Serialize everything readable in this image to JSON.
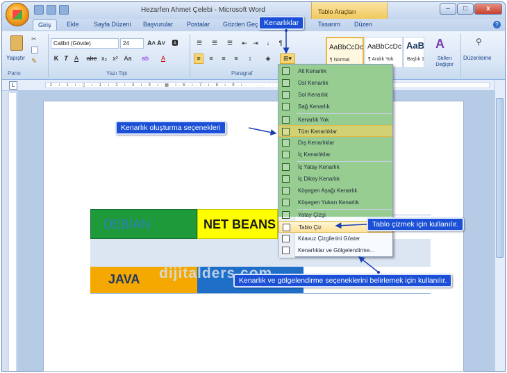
{
  "window": {
    "title": "Hezarfen Ahmet Çelebi - Microsoft Word",
    "context_tab_group": "Tablo Araçları"
  },
  "tabs": [
    {
      "label": "Giriş"
    },
    {
      "label": "Ekle"
    },
    {
      "label": "Sayfa Düzeni"
    },
    {
      "label": "Başvurular"
    },
    {
      "label": "Postalar"
    },
    {
      "label": "Gözden Geçi"
    },
    {
      "label": "Tasarım"
    },
    {
      "label": "Düzen"
    }
  ],
  "ribbon": {
    "paste_label": "Yapıştır",
    "font_name": "Calibri (Gövde)",
    "font_size": "24",
    "bold": "K",
    "italic": "T",
    "underline": "A",
    "strike": "abe",
    "subscript": "x₂",
    "superscript": "x²",
    "change_case": "Aa",
    "groups": {
      "clipboard": "Pano",
      "font": "Yazı Tipi",
      "paragraph": "Paragraf"
    },
    "styles": [
      {
        "preview": "AaBbCcDc",
        "name": "¶ Normal"
      },
      {
        "preview": "AaBbCcDc",
        "name": "¶ Aralık Yok"
      },
      {
        "preview": "AaBbC(",
        "name": "Başlık 1"
      }
    ],
    "change_styles": "Stilleri Değiştir",
    "editing": "Düzenleme"
  },
  "borders_button_tooltip": "Kenarlıklar",
  "menu": {
    "items": [
      "Alt Kenarlık",
      "Üst Kenarlık",
      "Sol Kenarlık",
      "Sağ Kenarlık",
      "Kenarlık Yok",
      "Tüm Kenarlıklar",
      "Dış Kenarlıklar",
      "İç Kenarlıklar",
      "İç Yatay Kenarlık",
      "İç Dikey Kenarlık",
      "Köşegen Aşağı Kenarlık",
      "Köşegen Yukarı Kenarlık",
      "Yatay Çizgi",
      "Tablo Çiz",
      "Kılavuz Çizgilerini Göster",
      "Kenarlıklar ve Gölgelendirme..."
    ]
  },
  "document": {
    "cells": [
      "DEBİAN",
      "NET BEANS",
      "JAVA"
    ],
    "watermark": "dijitalders.com"
  },
  "callouts": {
    "borders_options": "Kenarlık oluşturma seçenekleri",
    "draw_table": "Tablo çizmek için kullanılır.",
    "borders_shading": "Kenarlık ve gölgelendirme seçeneklerini belirlemek için kullanılır."
  },
  "colors": {
    "cell_green": "#1e9a3a",
    "cell_yellow": "#ffff00",
    "cell_orange": "#f5a800",
    "cell_blue": "#1f6fc8",
    "callout_blue": "#1a4fd6"
  }
}
